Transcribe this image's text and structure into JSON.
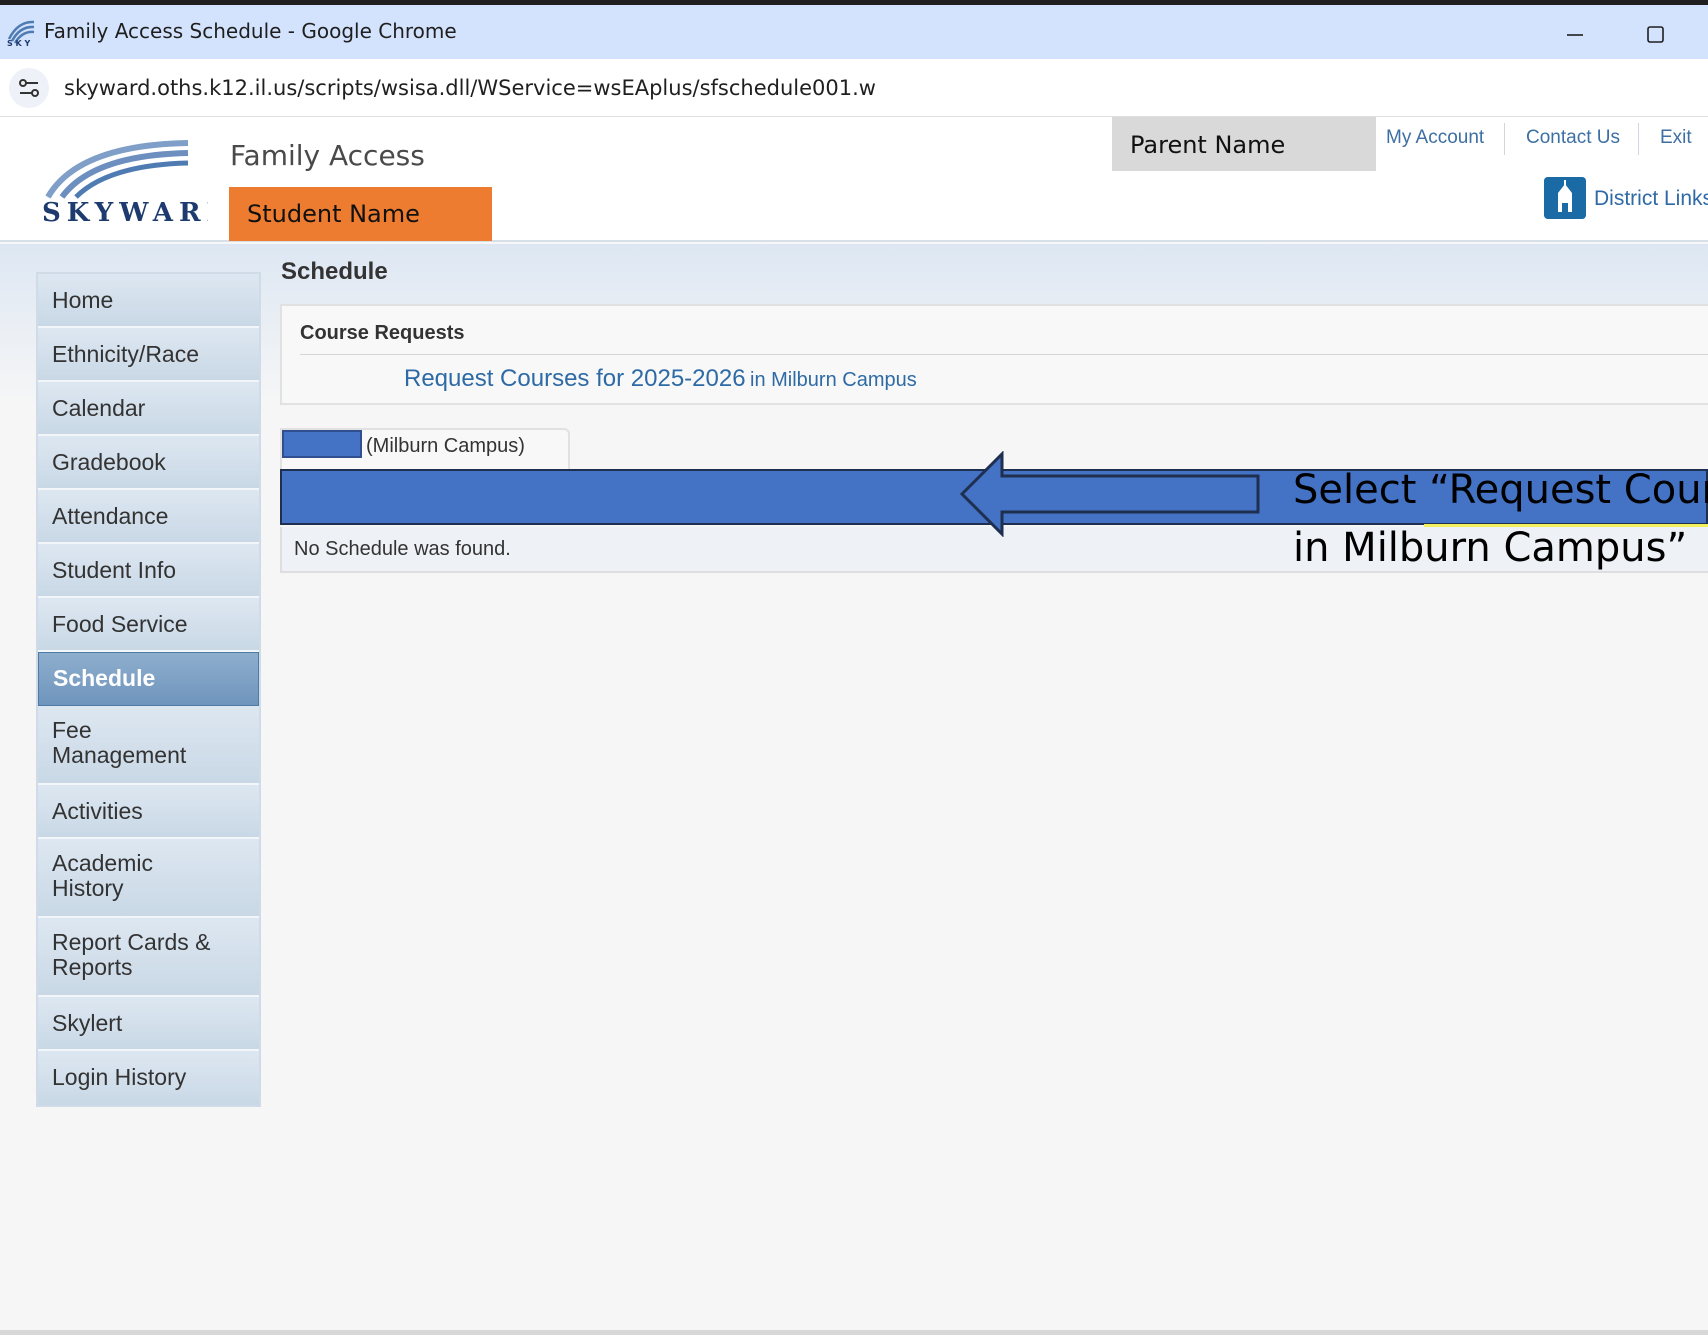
{
  "browser": {
    "window_title": "Family Access Schedule - Google Chrome",
    "url": "skyward.oths.k12.il.us/scripts/wsisa.dll/WService=wsEAplus/sfschedule001.w"
  },
  "header": {
    "logo_text": "SKYWARD",
    "app_name": "Family Access",
    "student_name": "Student Name",
    "parent_name": "Parent Name",
    "links": [
      "My Account",
      "Contact Us",
      "Exit"
    ],
    "district_links": "District Links"
  },
  "sidebar": {
    "items": [
      {
        "label": "Home"
      },
      {
        "label": "Ethnicity/Race"
      },
      {
        "label": "Calendar"
      },
      {
        "label": "Gradebook"
      },
      {
        "label": "Attendance"
      },
      {
        "label": "Student Info"
      },
      {
        "label": "Food Service"
      },
      {
        "label": "Schedule",
        "active": true
      },
      {
        "label": "Fee Management"
      },
      {
        "label": "Activities"
      },
      {
        "label": "Academic History"
      },
      {
        "label": "Report Cards & Reports"
      },
      {
        "label": "Skylert"
      },
      {
        "label": "Login History"
      }
    ]
  },
  "main": {
    "title": "Schedule",
    "course_requests": {
      "heading": "Course Requests",
      "link_text": "Request Courses for 2025-2026",
      "link_suffix": "in Milburn Campus"
    },
    "tab_label": "(Milburn Campus)",
    "empty_message": "No Schedule was found."
  },
  "annotation": {
    "line1": "Select “Request Courses",
    "line2": "in Milburn Campus”"
  },
  "colors": {
    "student_highlight": "#ee7c30",
    "parent_highlight": "#d9d9d9",
    "annotation_blue": "#4472c4",
    "link_blue": "#2e6aa5"
  }
}
